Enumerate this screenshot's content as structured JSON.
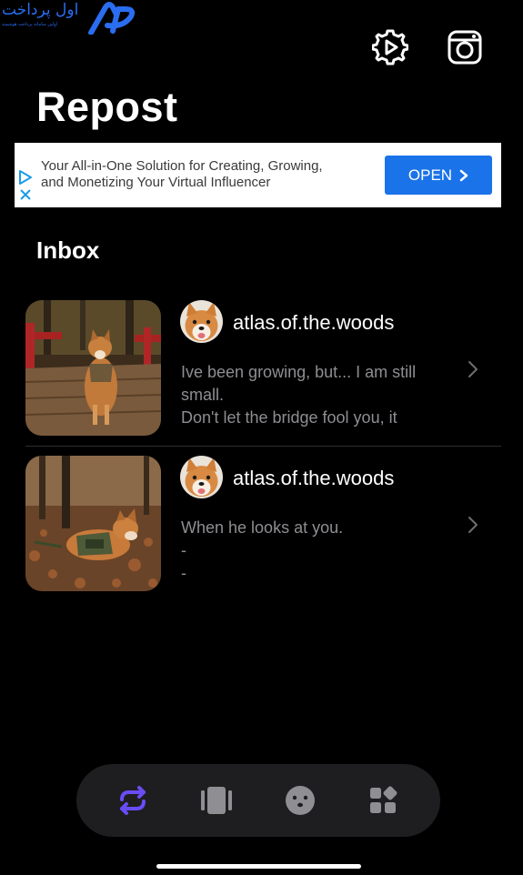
{
  "watermark": {
    "text": "اول پرداخت",
    "subtext": "اولین سامانه پرداخت هوشمند"
  },
  "header": {
    "title": "Repost",
    "settings_icon": "settings-play-icon",
    "camera_icon": "instagram-camera-icon"
  },
  "ad": {
    "line1": "Your All-in-One Solution for Creating, Growing,",
    "line2": "and Monetizing Your Virtual Influencer",
    "button_label": "OPEN"
  },
  "inbox": {
    "title": "Inbox",
    "items": [
      {
        "username": "atlas.of.the.woods",
        "preview_lines": [
          "Ive been growing, but... I am still",
          "small.",
          "Don't let the bridge fool you, it"
        ]
      },
      {
        "username": "atlas.of.the.woods",
        "preview_lines": [
          "When he looks at you.",
          "-",
          "-"
        ]
      }
    ]
  },
  "tabs": [
    {
      "name": "repost",
      "icon": "repost-arrows-icon",
      "active": true
    },
    {
      "name": "stories",
      "icon": "stories-cards-icon",
      "active": false
    },
    {
      "name": "face",
      "icon": "face-icon",
      "active": false
    },
    {
      "name": "apps",
      "icon": "apps-grid-icon",
      "active": false
    }
  ],
  "colors": {
    "background": "#000000",
    "accent_purple": "#6a4cf5",
    "ad_button_blue": "#1a73e8",
    "secondary_text": "#8e8e93",
    "tab_bar": "#1e1e20",
    "watermark_blue": "#2a6df0"
  }
}
